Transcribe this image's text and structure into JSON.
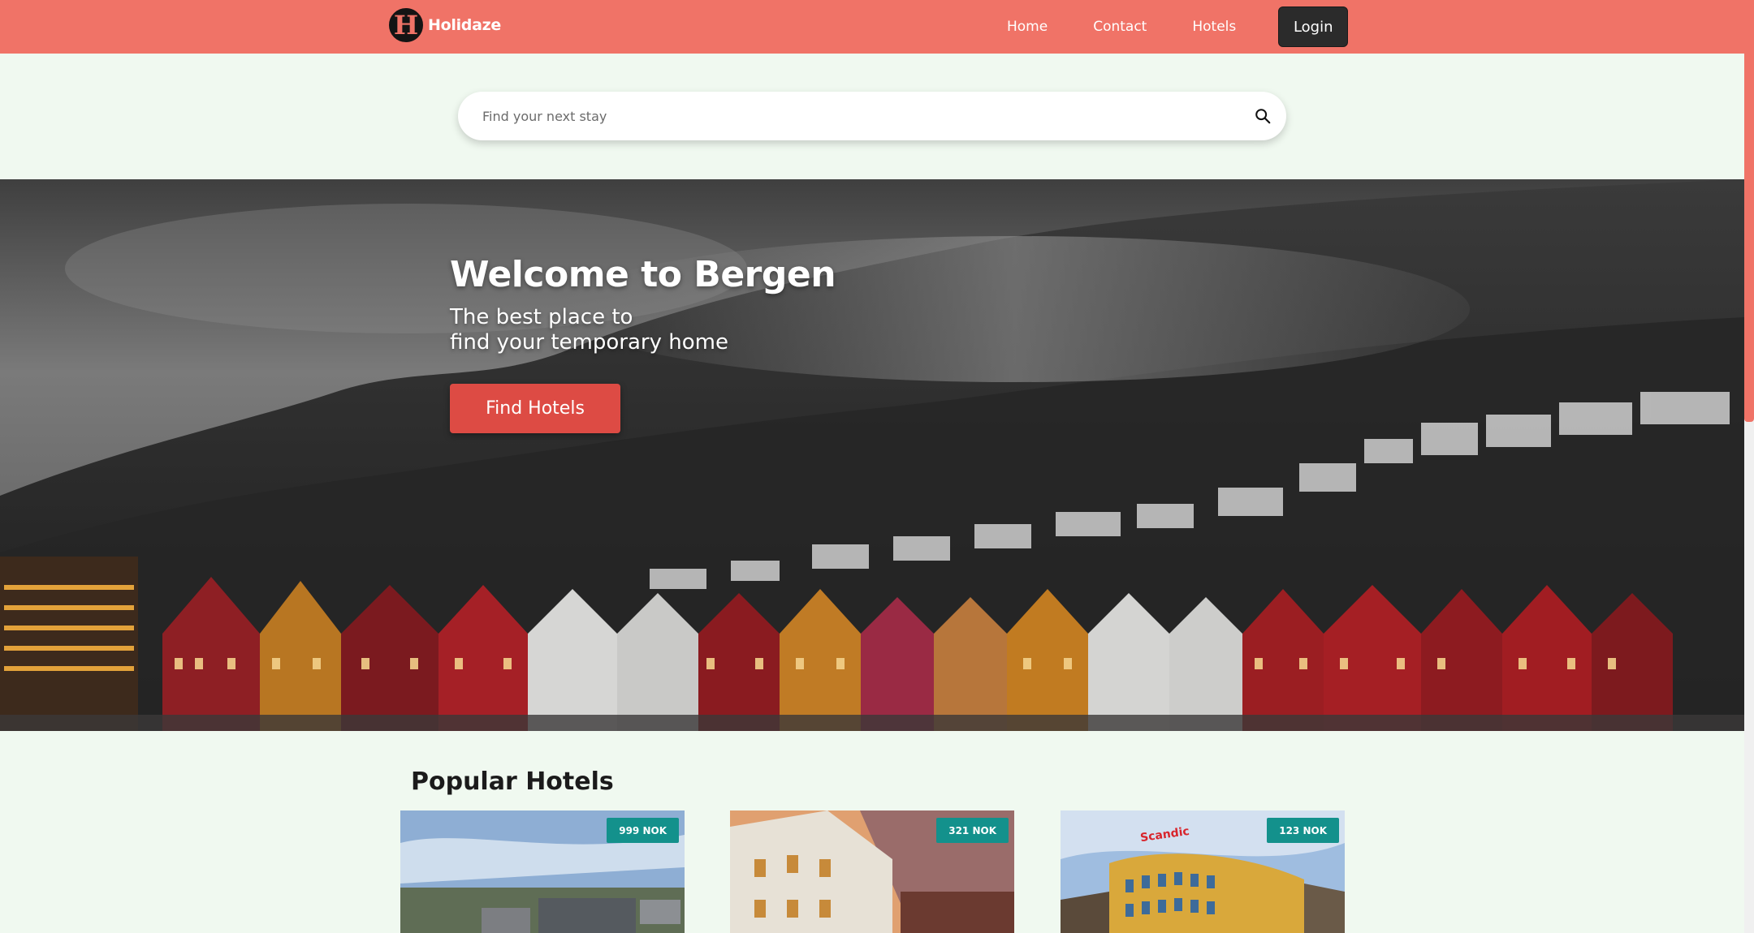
{
  "brand": {
    "name": "Holidaze",
    "mark": "H"
  },
  "nav": {
    "links": [
      "Home",
      "Contact",
      "Hotels"
    ],
    "login_label": "Login"
  },
  "search": {
    "placeholder": "Find your next stay",
    "value": "",
    "icon": "search-icon"
  },
  "hero": {
    "title": "Welcome to Bergen",
    "subtitle_line1": "The best place to",
    "subtitle_line2": "find your temporary home",
    "button_label": "Find Hotels"
  },
  "popular": {
    "title": "Popular Hotels",
    "hotels": [
      {
        "price": "999 NOK"
      },
      {
        "price": "321 NOK"
      },
      {
        "price": "123 NOK",
        "sign_text": "Scandic"
      }
    ]
  },
  "colors": {
    "nav_bg": "#f07367",
    "page_bg": "#f0f9f0",
    "login_bg": "#2b2b2b",
    "cta_bg": "#dd4b44",
    "badge_bg": "#13918c"
  }
}
